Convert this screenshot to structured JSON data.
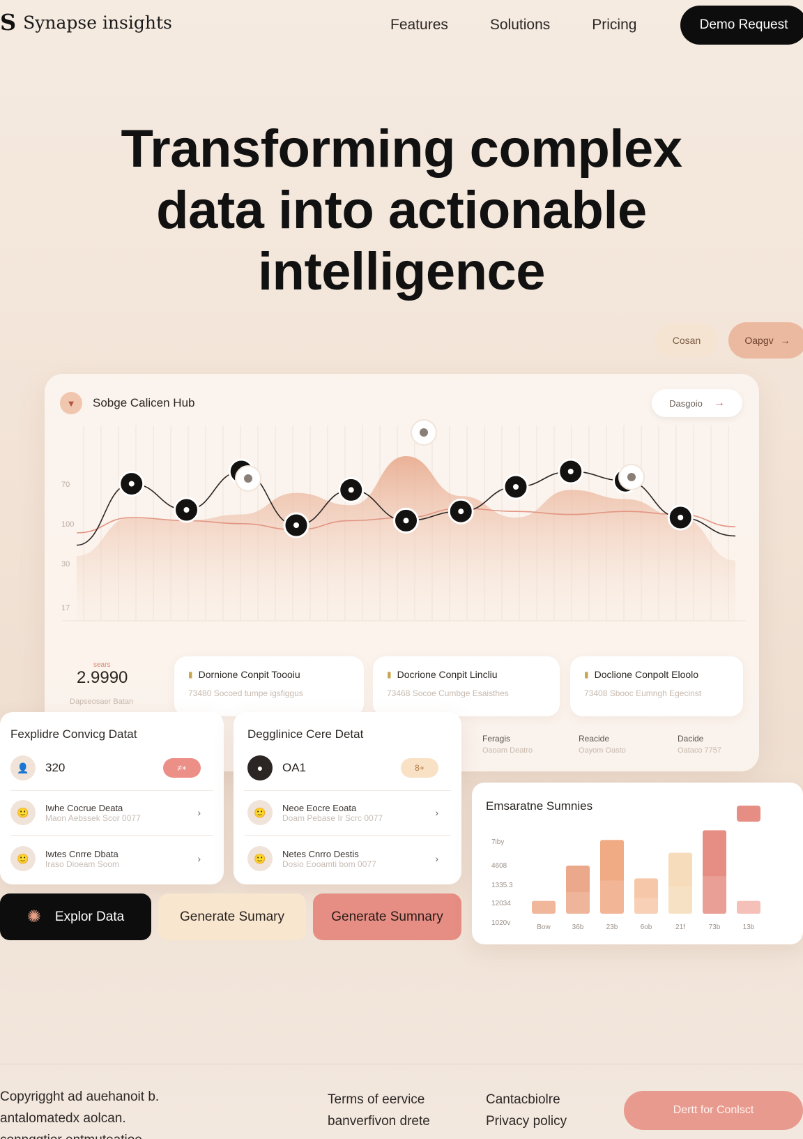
{
  "brand": {
    "mark": "S",
    "name": "Synapse insights"
  },
  "nav": {
    "items": [
      "Features",
      "Solutions",
      "Pricing"
    ],
    "demo_label": "Demo Request"
  },
  "hero": {
    "line1": "Transforming complex",
    "line2": "data into actionable",
    "line3": "intelligence"
  },
  "pills": {
    "left": "Cosan",
    "right": "Oapgv",
    "right_icon": "arrow-right-icon"
  },
  "dashboard": {
    "title": "Sobge Calicen Hub",
    "details_label": "Dasgoio",
    "chart_data": {
      "type": "line",
      "ylabels": [
        "70",
        "100",
        "30",
        "17"
      ],
      "series": [
        {
          "values": [
            22,
            62,
            45,
            70,
            35,
            58,
            38,
            44,
            60,
            70,
            64,
            40,
            28
          ]
        },
        {
          "values": [
            30,
            40,
            38,
            36,
            32,
            38,
            40,
            46,
            44,
            42,
            44,
            42,
            34
          ]
        }
      ],
      "area": [
        15,
        40,
        38,
        42,
        56,
        48,
        80,
        54,
        40,
        58,
        52,
        40,
        12
      ],
      "colors": {
        "line": "#2a2624",
        "line2": "#e29683",
        "area": "#eab49a",
        "marker": "#141210"
      }
    },
    "metric": {
      "label": "sears",
      "value": "2.9990",
      "sub": "Dapseosaer Batan"
    },
    "kpis": [
      {
        "title": "Dornione Conpit Toooiu",
        "sub": "73480 Socoed tumpe igsfiggus"
      },
      {
        "title": "Docrione Conpit Lincliu",
        "sub": "73468 Socoe Cumbge Esaisthes"
      },
      {
        "title": "Doclione Conpolt Eloolo",
        "sub": "73408 Sbooc Eumngh Egecinst"
      }
    ],
    "mini": [
      {
        "title": "Feragis",
        "sub": "Oaoam Deatro"
      },
      {
        "title": "Reacide",
        "sub": "Oayom Oasto"
      },
      {
        "title": "Dacide",
        "sub": "Oataco 7757"
      }
    ]
  },
  "list_cards": [
    {
      "title": "Fexplidre Convicg Datat",
      "top": {
        "value": "320",
        "tag": "≠+",
        "tag_bg": "#ec8f87",
        "tag_color": "#ffffff",
        "avatar_bg": "#f1e3d8"
      },
      "rows": [
        {
          "name": "Iwhe Cocrue Deata",
          "meta": "Maon Aebssek Scor 0077"
        },
        {
          "name": "Iwtes Cnrre Dbata",
          "meta": "Iraso Dioeam Soom"
        }
      ]
    },
    {
      "title": "Degglinice Cere Detat",
      "top": {
        "value": "OA1",
        "tag": "8+",
        "tag_bg": "#f9e1c6",
        "tag_color": "#b07a48",
        "avatar_bg": "#2b2624"
      },
      "rows": [
        {
          "name": "Neoe Eocre Eoata",
          "meta": "Doam Pebase Ir Scrc 0077"
        },
        {
          "name": "Netes Cnrro Destis",
          "meta": "Dosio Eooamti bom 0077"
        }
      ]
    }
  ],
  "actions": {
    "explore": "Explor Data",
    "summary1": "Generate Sumary",
    "summary2": "Generate Sumnary"
  },
  "summary_card": {
    "title": "Emsaratne Sumnies",
    "chart_data": {
      "type": "bar",
      "ylabels": [
        "7iby",
        "4608",
        "1335.3",
        "12034",
        "1020v"
      ],
      "categories": [
        "Bow",
        "36b",
        "23b",
        "6ob",
        "21f",
        "73b",
        "13b"
      ],
      "values": [
        8,
        30,
        46,
        22,
        38,
        52,
        8
      ],
      "top_segment_value": 10,
      "colors": [
        "#f0b79a",
        "#eca88a",
        "#f0aa84",
        "#f6c8a9",
        "#f6dcba",
        "#e68e84",
        "#f5c0b8"
      ]
    }
  },
  "footer": {
    "lines": [
      "Copyrigght ad auehanoit b.",
      "antalomatedx aolcan.",
      "connggtior entmuteatioe"
    ],
    "col1": [
      "Terms of eervice",
      "banverfivon drete"
    ],
    "col2": [
      "Cantacbiolre",
      "Privacy policy"
    ],
    "contact": "Dertt for Conlsct"
  }
}
